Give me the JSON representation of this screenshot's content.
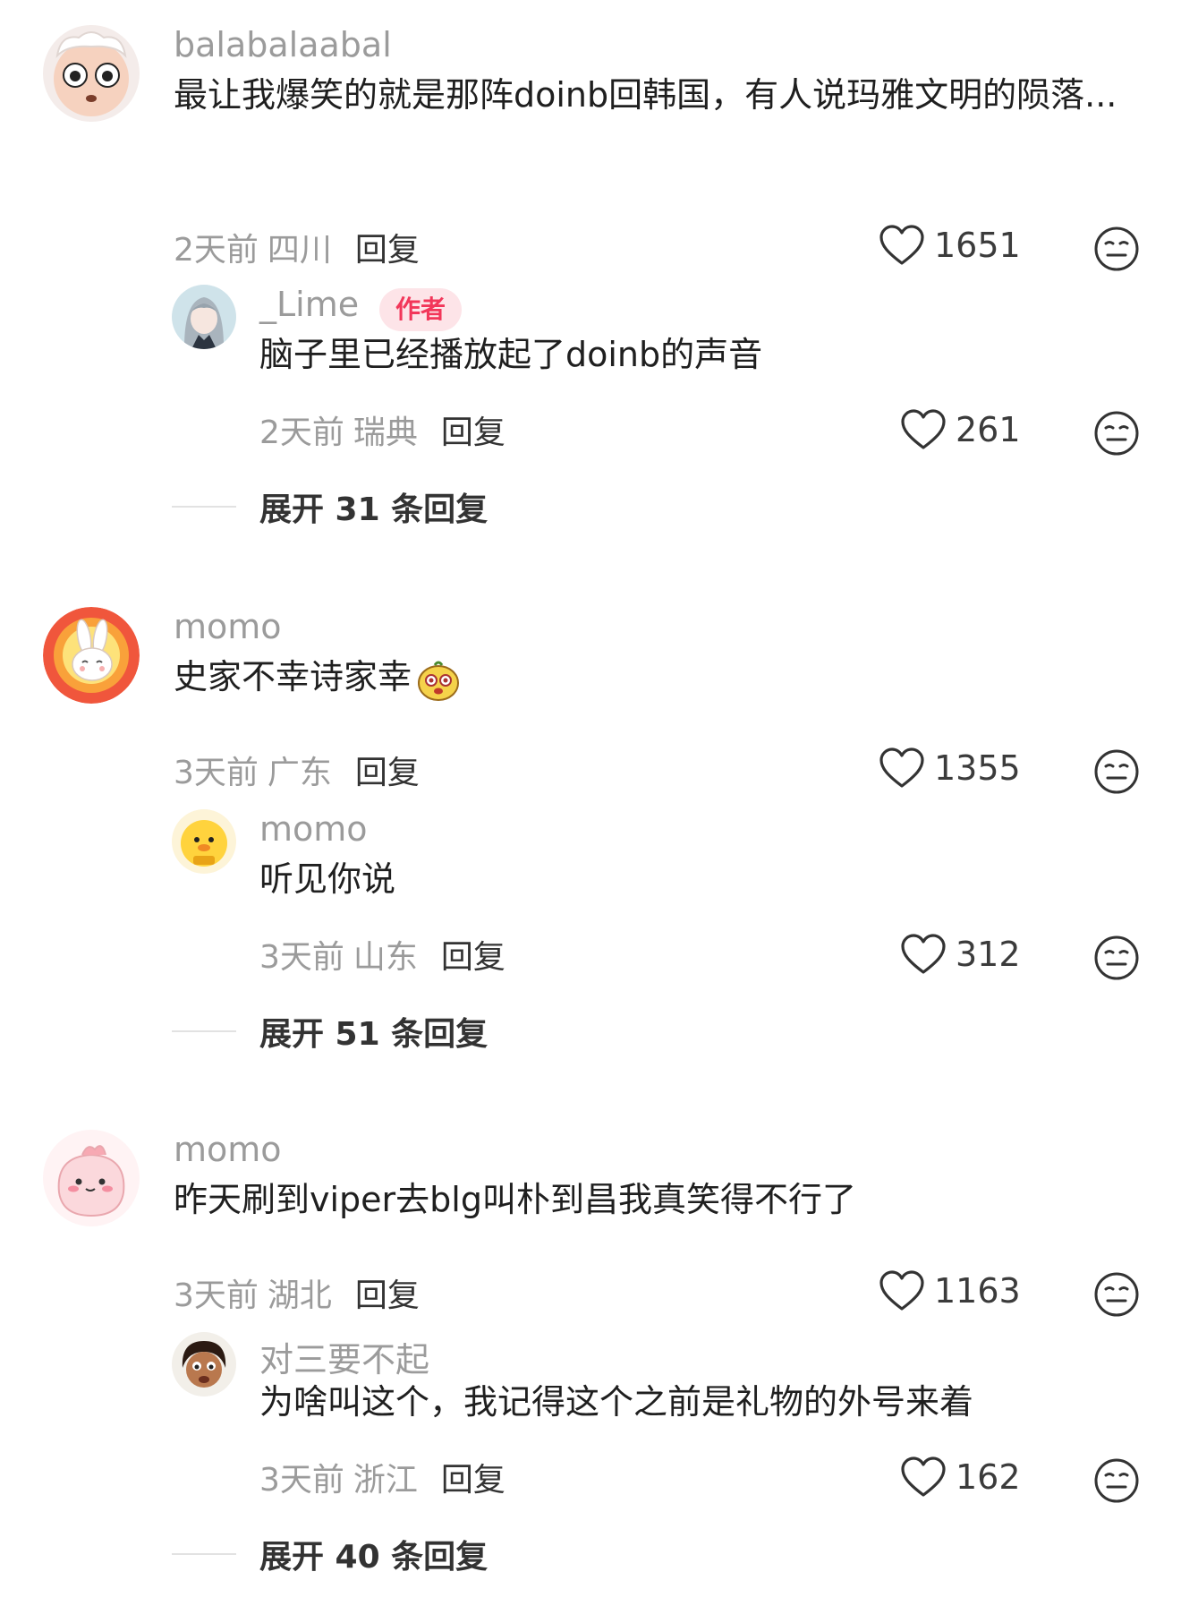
{
  "threads": [
    {
      "comment": {
        "username": "balabalaabal",
        "text": "最让我爆笑的就是那阵doinb回韩国，有人说玛雅文明的陨落...",
        "time": "2天前",
        "location": "四川",
        "reply_label": "回复",
        "likes": "1651",
        "avatar_icon": "sheep-face-avatar"
      },
      "reply": {
        "username": "_Lime",
        "badge": "作者",
        "text": "脑子里已经播放起了doinb的声音",
        "time": "2天前",
        "location": "瑞典",
        "reply_label": "回复",
        "likes": "261",
        "avatar_icon": "anime-girl-avatar"
      },
      "expand_label": "展开 31 条回复"
    },
    {
      "comment": {
        "username": "momo",
        "text": "史家不幸诗家幸",
        "text_emoji": "face-emoji",
        "time": "3天前",
        "location": "广东",
        "reply_label": "回复",
        "likes": "1355",
        "avatar_icon": "bunny-sun-avatar"
      },
      "reply": {
        "username": "momo",
        "text": "听见你说",
        "time": "3天前",
        "location": "山东",
        "reply_label": "回复",
        "likes": "312",
        "avatar_icon": "yellow-duck-avatar"
      },
      "expand_label": "展开 51 条回复"
    },
    {
      "comment": {
        "username": "momo",
        "text": "昨天刷到viper去blg叫朴到昌我真笑得不行了",
        "time": "3天前",
        "location": "湖北",
        "reply_label": "回复",
        "likes": "1163",
        "avatar_icon": "pink-blob-avatar"
      },
      "reply": {
        "username": "对三要不起",
        "text": "为啥叫这个，我记得这个之前是礼物的外号来着",
        "time": "3天前",
        "location": "浙江",
        "reply_label": "回复",
        "likes": "162",
        "avatar_icon": "cartoon-man-avatar"
      },
      "expand_label": "展开 40 条回复"
    }
  ],
  "colors": {
    "secondary_text": "#9b9b9b",
    "badge_bg": "#fde4e8",
    "badge_text": "#f2375a"
  }
}
